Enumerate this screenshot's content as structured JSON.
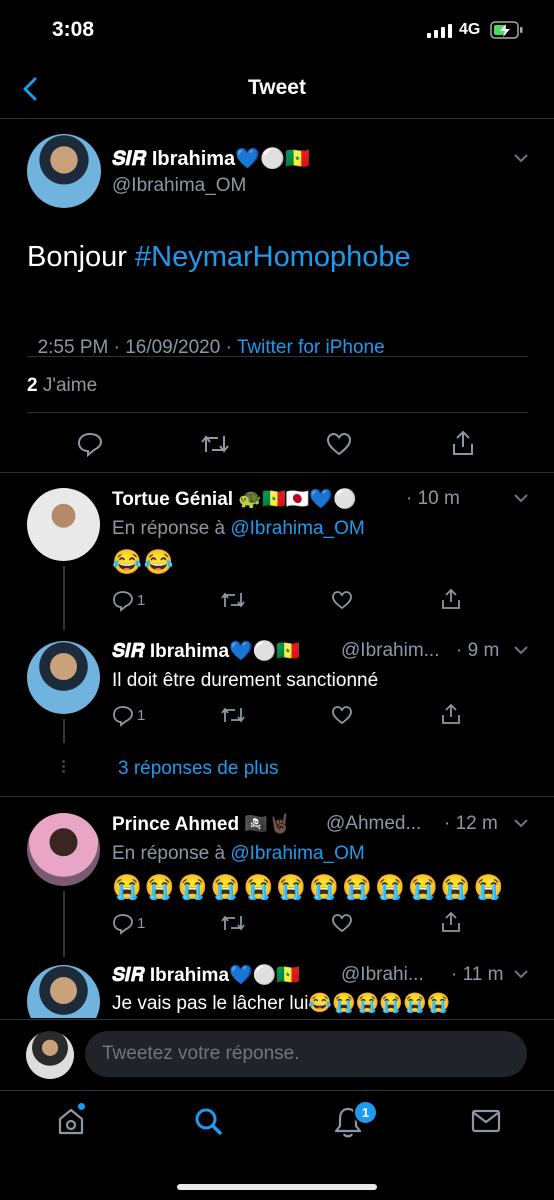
{
  "status_bar": {
    "time": "3:08",
    "network": "4G"
  },
  "nav": {
    "title": "Tweet"
  },
  "main_tweet": {
    "name": "𝑺𝑰𝑹 Ibrahima💙⚪🇸🇳",
    "handle": "@Ibrahima_OM",
    "text_prefix": "Bonjour ",
    "hashtag": "#NeymarHomophobe",
    "timestamp": "2:55 PM · 16/09/2020 · ",
    "source": "Twitter for iPhone",
    "likes_count": "2",
    "likes_label": "J'aime"
  },
  "replies": [
    {
      "name": "Tortue Génial 🐢🇸🇳🇯🇵💙⚪",
      "handle": "",
      "time": "· 10 m",
      "reply_prefix": "En réponse à ",
      "reply_to": "@Ibrahima_OM",
      "text": "😂😂",
      "reply_count": "1"
    },
    {
      "name": "𝑺𝑰𝑹 Ibrahima💙⚪🇸🇳",
      "handle": "@Ibrahim...",
      "time": "· 9 m",
      "text": "Il doit être durement sanctionné",
      "reply_count": "1"
    },
    {
      "name": "Prince Ahmed 🏴‍☠️🤘🏿",
      "handle": "@Ahmed...",
      "time": "· 12 m",
      "reply_prefix": "En réponse à ",
      "reply_to": "@Ibrahima_OM",
      "text": "😭😭😭😭😭😭😭😭😭😭😭😭",
      "reply_count": "1"
    },
    {
      "name": "𝑺𝑰𝑹 Ibrahima💙⚪🇸🇳",
      "handle": "@Ibrahi...",
      "time": "· 11 m",
      "text": "Je vais pas le lâcher lui😂😭😭😭😭😭"
    }
  ],
  "more_replies": "3 réponses de plus",
  "composer": {
    "placeholder": "Tweetez votre réponse."
  },
  "tab_bar": {
    "notifications_badge": "1"
  },
  "colors": {
    "accent": "#1d9bf0",
    "background": "#000000",
    "muted": "#8b98a5"
  }
}
